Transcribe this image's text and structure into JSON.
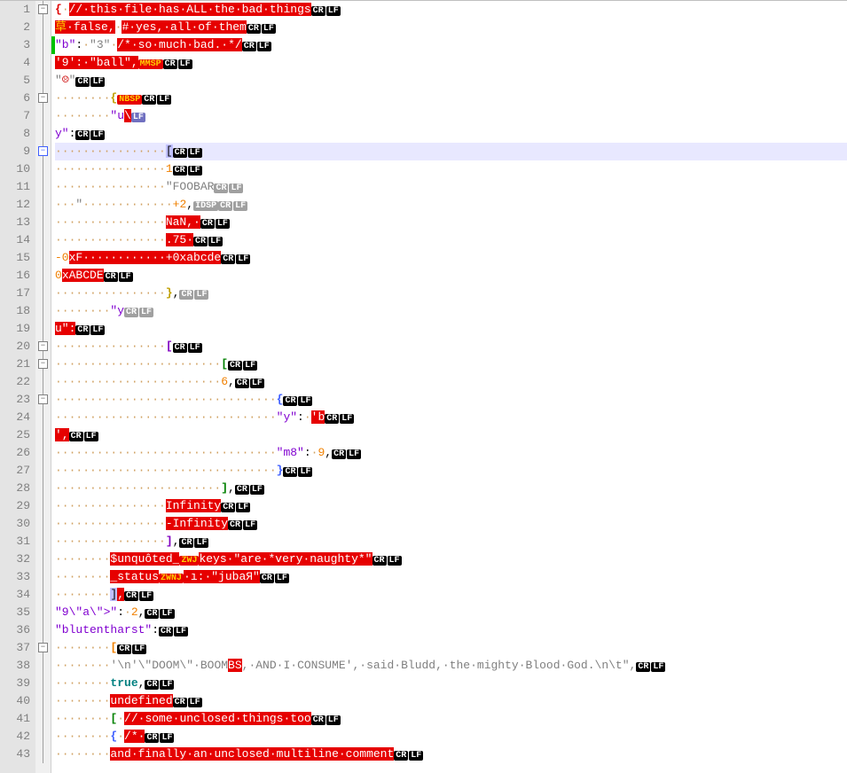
{
  "lineCount": 43,
  "highlightedLine": 9,
  "changedLines": [
    3
  ],
  "foldBoxes": [
    1,
    6,
    9,
    20,
    21,
    23,
    37
  ],
  "foldBoxBlue": 9,
  "lines": {
    "l1": {
      "segs": [
        [
          "bracket0",
          "{"
        ],
        [
          "ws",
          "·"
        ],
        [
          "comment-err",
          "//·this·file·has·ALL·the·bad·things"
        ],
        [
          "crlf",
          ""
        ]
      ]
    },
    "l2": {
      "segs": [
        [
          "err-yel",
          "草"
        ],
        [
          "err",
          "·false,"
        ],
        [
          "ws",
          "·"
        ],
        [
          "comment-err",
          "#·yes,·all·of·them"
        ],
        [
          "crlf",
          ""
        ]
      ]
    },
    "l3": {
      "segs": [
        [
          "key",
          "\"b\""
        ],
        [
          "punct",
          ":"
        ],
        [
          "ws",
          "·"
        ],
        [
          "str",
          "\"3\""
        ],
        [
          "ws",
          "·"
        ],
        [
          "comment-err",
          "/*·so·much·bad.·*/"
        ],
        [
          "crlf",
          ""
        ]
      ]
    },
    "l4": {
      "segs": [
        [
          "err",
          "'9':·\"ball\","
        ],
        [
          "tag-yel",
          "MMSP"
        ],
        [
          "crlf",
          ""
        ]
      ]
    },
    "l5": {
      "segs": [
        [
          "str",
          "\""
        ],
        [
          "emoji",
          "☹"
        ],
        [
          "str",
          "\""
        ],
        [
          "crlf",
          ""
        ]
      ]
    },
    "l6": {
      "segs": [
        [
          "ws",
          "········"
        ],
        [
          "bracket1",
          "{"
        ],
        [
          "tag-yel",
          "NBSP"
        ],
        [
          "crlf",
          ""
        ]
      ]
    },
    "l7": {
      "segs": [
        [
          "ws",
          "········"
        ],
        [
          "key",
          "\"u"
        ],
        [
          "err",
          "\\"
        ],
        [
          "lf-only",
          ""
        ]
      ]
    },
    "l8": {
      "segs": [
        [
          "key",
          "y\""
        ],
        [
          "punct",
          ":"
        ],
        [
          "crlf",
          ""
        ]
      ]
    },
    "l9": {
      "segs": [
        [
          "ws",
          "················"
        ],
        [
          "cur-bracket",
          "["
        ],
        [
          "crlf",
          ""
        ]
      ]
    },
    "l10": {
      "segs": [
        [
          "ws",
          "················"
        ],
        [
          "num",
          "1"
        ],
        [
          "crlf",
          ""
        ]
      ]
    },
    "l11": {
      "segs": [
        [
          "ws",
          "················"
        ],
        [
          "str",
          "\"FOOBAR"
        ],
        [
          "strcar",
          "^"
        ],
        [
          "crlf-gray",
          ""
        ]
      ]
    },
    "l12": {
      "segs": [
        [
          "ws",
          "···"
        ],
        [
          "str",
          "\""
        ],
        [
          "ws",
          "·············"
        ],
        [
          "num",
          "+2"
        ],
        [
          "punct",
          ","
        ],
        [
          "tag-gray",
          "IDSP"
        ],
        [
          "crlf-gray",
          ""
        ]
      ]
    },
    "l13": {
      "segs": [
        [
          "ws",
          "················"
        ],
        [
          "err",
          "NaN,"
        ],
        [
          "ws-err",
          "·"
        ],
        [
          "crlf",
          ""
        ]
      ]
    },
    "l14": {
      "segs": [
        [
          "ws",
          "················"
        ],
        [
          "err",
          ".75"
        ],
        [
          "ws-err",
          "·"
        ],
        [
          "crlf",
          ""
        ]
      ]
    },
    "l15": {
      "segs": [
        [
          "num",
          "-0"
        ],
        [
          "err",
          "xF············+0xabcde"
        ],
        [
          "crlf",
          ""
        ]
      ]
    },
    "l16": {
      "segs": [
        [
          "num",
          "0"
        ],
        [
          "err",
          "xABCDE"
        ],
        [
          "crlf",
          ""
        ]
      ]
    },
    "l17": {
      "segs": [
        [
          "ws",
          "················"
        ],
        [
          "bracket1",
          "}"
        ],
        [
          "punct",
          ","
        ],
        [
          "crlf-gray",
          ""
        ]
      ]
    },
    "l18": {
      "segs": [
        [
          "ws",
          "········"
        ],
        [
          "key",
          "\"y"
        ],
        [
          "strcar",
          "^"
        ],
        [
          "crlf-gray",
          ""
        ]
      ]
    },
    "l19": {
      "segs": [
        [
          "err",
          "u\":"
        ],
        [
          "crlf",
          ""
        ]
      ]
    },
    "l20": {
      "segs": [
        [
          "ws",
          "················"
        ],
        [
          "bracket2",
          "["
        ],
        [
          "crlf",
          ""
        ]
      ]
    },
    "l21": {
      "segs": [
        [
          "ws",
          "························"
        ],
        [
          "bracket3",
          "["
        ],
        [
          "crlf",
          ""
        ]
      ]
    },
    "l22": {
      "segs": [
        [
          "ws",
          "························"
        ],
        [
          "num",
          "6"
        ],
        [
          "punct",
          ","
        ],
        [
          "crlf",
          ""
        ]
      ]
    },
    "l23": {
      "segs": [
        [
          "ws",
          "································"
        ],
        [
          "bracket4",
          "{"
        ],
        [
          "crlf",
          ""
        ]
      ]
    },
    "l24": {
      "segs": [
        [
          "ws",
          "································"
        ],
        [
          "key",
          "\"y\""
        ],
        [
          "punct",
          ":"
        ],
        [
          "ws",
          "·"
        ],
        [
          "err",
          "'b"
        ],
        [
          "crlf",
          ""
        ]
      ]
    },
    "l25": {
      "segs": [
        [
          "err",
          "',"
        ],
        [
          "crlf",
          ""
        ]
      ]
    },
    "l26": {
      "segs": [
        [
          "ws",
          "································"
        ],
        [
          "key",
          "\"m8\""
        ],
        [
          "punct",
          ":"
        ],
        [
          "ws",
          "·"
        ],
        [
          "num",
          "9"
        ],
        [
          "punct",
          ","
        ],
        [
          "crlf",
          ""
        ]
      ]
    },
    "l27": {
      "segs": [
        [
          "ws",
          "································"
        ],
        [
          "bracket4",
          "}"
        ],
        [
          "crlf",
          ""
        ]
      ]
    },
    "l28": {
      "segs": [
        [
          "ws",
          "························"
        ],
        [
          "bracket3",
          "]"
        ],
        [
          "punct",
          ","
        ],
        [
          "crlf",
          ""
        ]
      ]
    },
    "l29": {
      "segs": [
        [
          "ws",
          "················"
        ],
        [
          "err",
          "Infinity"
        ],
        [
          "crlf",
          ""
        ]
      ]
    },
    "l30": {
      "segs": [
        [
          "ws",
          "················"
        ],
        [
          "err",
          "-Infinity"
        ],
        [
          "crlf",
          ""
        ]
      ]
    },
    "l31": {
      "segs": [
        [
          "ws",
          "················"
        ],
        [
          "bracket2",
          "]"
        ],
        [
          "punct",
          ","
        ],
        [
          "crlf",
          ""
        ]
      ]
    },
    "l32": {
      "segs": [
        [
          "ws",
          "········"
        ],
        [
          "err",
          "$unquôted_"
        ],
        [
          "tag-yel",
          "ZWJ"
        ],
        [
          "err",
          "keys·\"are·*very·naughty*\""
        ],
        [
          "crlf",
          ""
        ]
      ]
    },
    "l33": {
      "segs": [
        [
          "ws",
          "········"
        ],
        [
          "err",
          "_status"
        ],
        [
          "tag-yel",
          "ZWNJ"
        ],
        [
          "err",
          "·ı:·\"jubaЯ\""
        ],
        [
          "crlf",
          ""
        ]
      ]
    },
    "l34": {
      "segs": [
        [
          "ws",
          "········"
        ],
        [
          "cur-bracket",
          "]"
        ],
        [
          "err",
          ","
        ],
        [
          "crlf",
          ""
        ]
      ]
    },
    "l35": {
      "segs": [
        [
          "key",
          "\"9\\\"a\\\">\""
        ],
        [
          "punct",
          ":"
        ],
        [
          "ws",
          "·"
        ],
        [
          "num",
          "2"
        ],
        [
          "punct",
          ","
        ],
        [
          "crlf",
          ""
        ]
      ]
    },
    "l36": {
      "segs": [
        [
          "key",
          "\"blutentharst\""
        ],
        [
          "punct",
          ":"
        ],
        [
          "crlf",
          ""
        ]
      ]
    },
    "l37": {
      "segs": [
        [
          "ws",
          "········"
        ],
        [
          "bracket5",
          "["
        ],
        [
          "crlf",
          ""
        ]
      ]
    },
    "l38": {
      "segs": [
        [
          "ws",
          "········"
        ],
        [
          "str",
          "'\\n'\\\"DOOM\\\"·BOOM"
        ],
        [
          "err",
          "BS"
        ],
        [
          "str",
          ",·AND·I·CONSUME',·said·Bludd,·the·mighty·Blood·God.\\n\\t\","
        ],
        [
          "crlf",
          ""
        ]
      ]
    },
    "l39": {
      "segs": [
        [
          "ws",
          "········"
        ],
        [
          "bool",
          "true"
        ],
        [
          "punct",
          ","
        ],
        [
          "crlf",
          ""
        ]
      ]
    },
    "l40": {
      "segs": [
        [
          "ws",
          "········"
        ],
        [
          "err",
          "undefined"
        ],
        [
          "crlf",
          ""
        ]
      ]
    },
    "l41": {
      "segs": [
        [
          "ws",
          "········"
        ],
        [
          "bracket3",
          "["
        ],
        [
          "ws",
          "·"
        ],
        [
          "comment-err",
          "//·some·unclosed·things·too"
        ],
        [
          "crlf",
          ""
        ]
      ]
    },
    "l42": {
      "segs": [
        [
          "ws",
          "········"
        ],
        [
          "bracket4",
          "{"
        ],
        [
          "ws",
          "·"
        ],
        [
          "comment-err",
          "/*·"
        ],
        [
          "crlf",
          ""
        ]
      ]
    },
    "l43": {
      "segs": [
        [
          "ws",
          "········"
        ],
        [
          "comment-err",
          "and·finally·an·unclosed·multiline·comment"
        ],
        [
          "crlf",
          ""
        ]
      ]
    }
  }
}
